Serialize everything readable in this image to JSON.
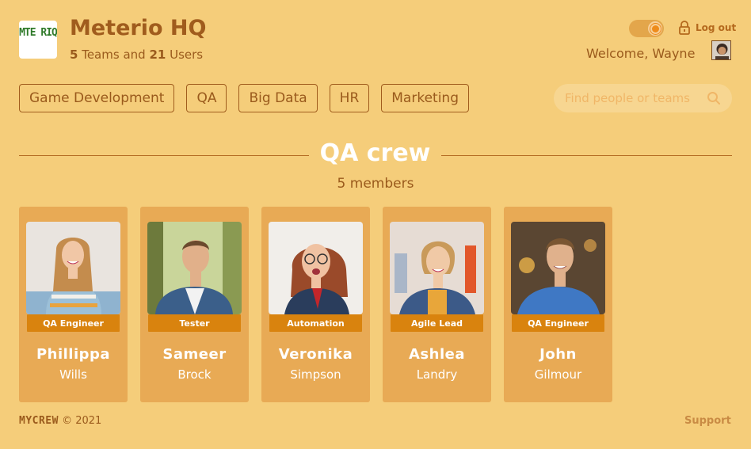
{
  "header": {
    "logo_text": "MTE RIQ",
    "title": "Meterio HQ",
    "teams_count": "5",
    "teams_label": "Teams and",
    "users_count": "21",
    "users_label": "Users",
    "logout_label": "Log out",
    "welcome": "Welcome, Wayne"
  },
  "tabs": [
    {
      "label": "Game Development"
    },
    {
      "label": "QA"
    },
    {
      "label": "Big Data"
    },
    {
      "label": "HR"
    },
    {
      "label": "Marketing"
    }
  ],
  "search": {
    "placeholder": "Find people or teams"
  },
  "team": {
    "title": "QA crew",
    "members_label": "5 members"
  },
  "members": [
    {
      "first": "Phillippa",
      "last": "Wills",
      "role": "QA Engineer"
    },
    {
      "first": "Sameer",
      "last": "Brock",
      "role": "Tester"
    },
    {
      "first": "Veronika",
      "last": "Simpson",
      "role": "Automation"
    },
    {
      "first": "Ashlea",
      "last": "Landry",
      "role": "Agile Lead"
    },
    {
      "first": "John",
      "last": "Gilmour",
      "role": "QA Engineer"
    }
  ],
  "footer": {
    "brand": "MYCREW",
    "copyright": "© 2021",
    "support": "Support"
  },
  "colors": {
    "background": "#f5cd7a",
    "card": "#e8aa55",
    "role_badge": "#d9830e",
    "text": "#9a5a1c"
  }
}
